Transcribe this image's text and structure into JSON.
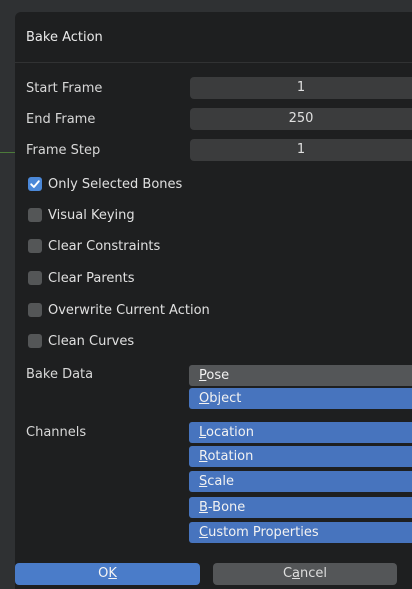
{
  "dialog": {
    "title": "Bake Action",
    "fields": {
      "start_frame": {
        "label": "Start Frame",
        "value": "1"
      },
      "end_frame": {
        "label": "End Frame",
        "value": "250"
      },
      "frame_step": {
        "label": "Frame Step",
        "value": "1"
      }
    },
    "options": [
      {
        "label": "Only Selected Bones",
        "checked": true
      },
      {
        "label": "Visual Keying",
        "checked": false
      },
      {
        "label": "Clear Constraints",
        "checked": false
      },
      {
        "label": "Clear Parents",
        "checked": false
      },
      {
        "label": "Overwrite Current Action",
        "checked": false
      },
      {
        "label": "Clean Curves",
        "checked": false
      }
    ],
    "bake_data": {
      "label": "Bake Data",
      "items": [
        {
          "label_first": "P",
          "label_rest": "ose",
          "selected": false
        },
        {
          "label_first": "O",
          "label_rest": "bject",
          "selected": true
        }
      ]
    },
    "channels": {
      "label": "Channels",
      "items": [
        {
          "label_first": "L",
          "label_rest": "ocation",
          "selected": true
        },
        {
          "label_first": "R",
          "label_rest": "otation",
          "selected": true
        },
        {
          "label_first": "S",
          "label_rest": "cale",
          "selected": true
        },
        {
          "label_first": "B",
          "label_rest": "-Bone",
          "selected": true
        },
        {
          "label_first": "C",
          "label_rest": "ustom Properties",
          "selected": true
        }
      ]
    },
    "buttons": {
      "ok_pre": "O",
      "ok_ul": "K",
      "cancel_pre": "C",
      "cancel_ul": "a",
      "cancel_post": "ncel"
    }
  },
  "colors": {
    "accent": "#4b88d8",
    "enum_selected": "#4774be",
    "dialog_bg": "#1e1f20"
  }
}
